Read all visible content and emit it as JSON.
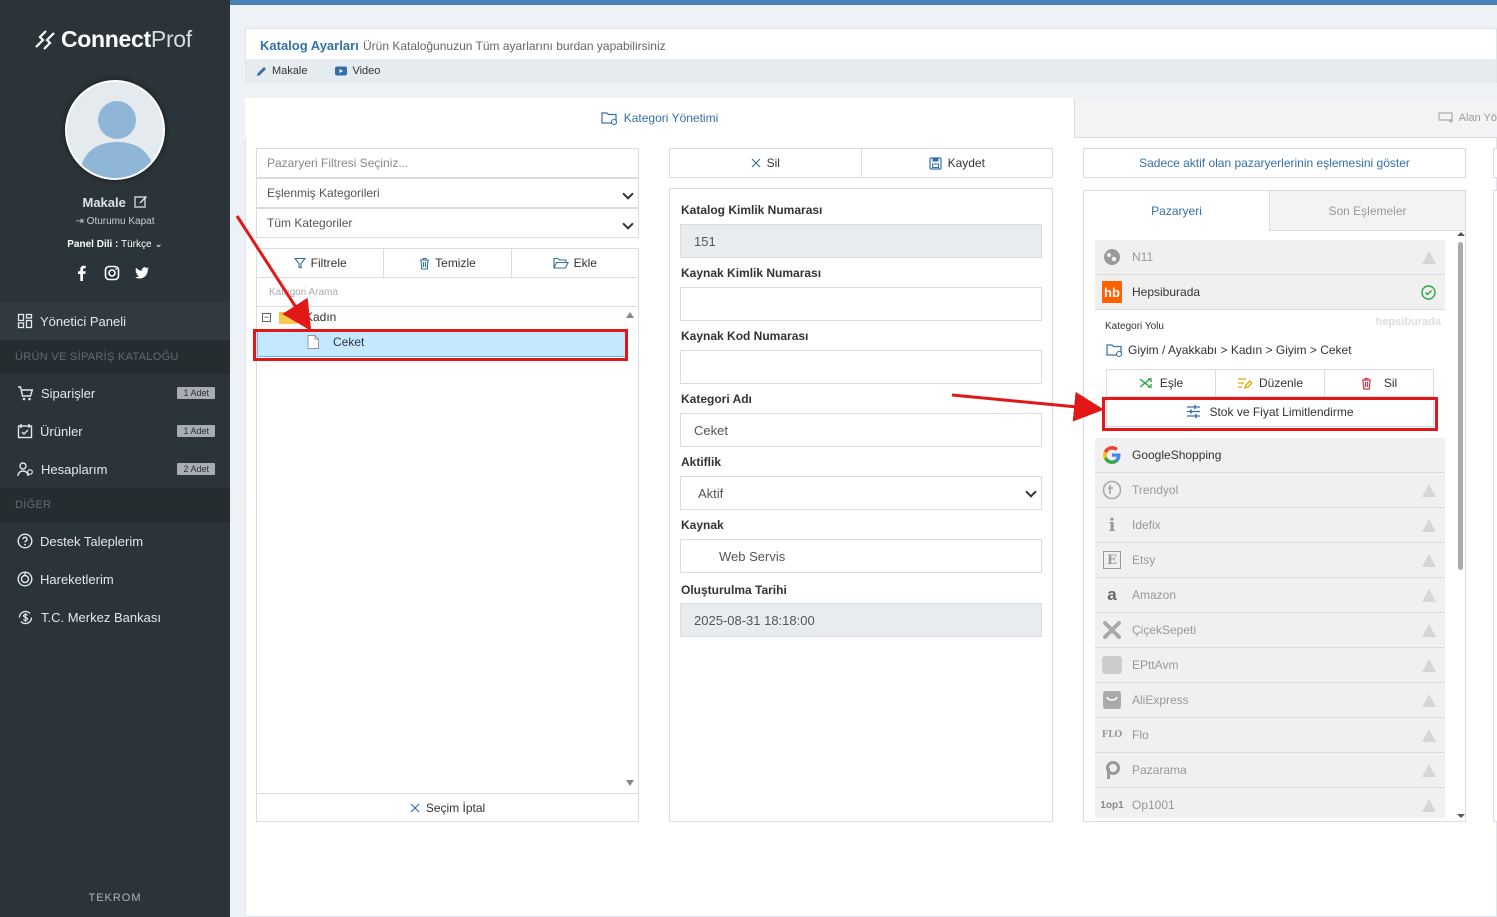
{
  "sidebar": {
    "logo_main": "Connect",
    "logo_suffix": "Prof",
    "user_name": "Makale",
    "logout": "Oturumu Kapat",
    "lang_label": "Panel Dili :",
    "lang_value": "Türkçe",
    "menu": [
      {
        "label": "Yönetici Paneli",
        "icon": "dashboard-icon"
      },
      {
        "section": "ÜRÜN VE SİPARİŞ KATALOĞU"
      },
      {
        "label": "Siparişler",
        "badge": "1 Adet",
        "icon": "cart-icon"
      },
      {
        "label": "Ürünler",
        "badge": "1 Adet",
        "icon": "products-icon"
      },
      {
        "label": "Hesaplarım",
        "badge": "2 Adet",
        "icon": "accounts-icon"
      },
      {
        "section": "DİĞER"
      },
      {
        "label": "Destek Taleplerim",
        "icon": "help-icon"
      },
      {
        "label": "Hareketlerim",
        "icon": "history-icon"
      },
      {
        "label": "T.C. Merkez Bankası",
        "icon": "currency-icon"
      }
    ],
    "footer": "TEKROM"
  },
  "header": {
    "title": "Katalog Ayarları",
    "subtitle": "Ürün Kataloğunuzun Tüm ayarlarını burdan yapabilirsiniz",
    "links": [
      "Makale",
      "Video"
    ]
  },
  "tabs": {
    "active": "Kategori Yönetimi",
    "other": "Alan Yö"
  },
  "left_panel": {
    "filter_placeholder": "Pazaryeri Filtresi Seçiniz...",
    "select1": "Eşlenmiş Kategorileri",
    "select2": "Tüm Kategoriler",
    "buttons": [
      "Filtrele",
      "Temizle",
      "Ekle"
    ],
    "search_placeholder": "Kategori Arama",
    "tree": {
      "parent": "Kadın",
      "child": "Ceket"
    },
    "cancel": "Seçim İptal"
  },
  "middle_panel": {
    "delete": "Sil",
    "save": "Kaydet",
    "fields": [
      {
        "label": "Katalog Kimlik Numarası",
        "value": "151",
        "readonly": true
      },
      {
        "label": "Kaynak Kimlik Numarası",
        "value": ""
      },
      {
        "label": "Kaynak Kod Numarası",
        "value": ""
      },
      {
        "label": "Kategori Adı",
        "value": "Ceket"
      },
      {
        "label": "Aktiflik",
        "value": "Aktif"
      },
      {
        "label": "Kaynak",
        "value": "Web Servis"
      },
      {
        "label": "Oluşturulma Tarihi",
        "value": "2025-08-31 18:18:00",
        "readonly": true
      }
    ]
  },
  "right_panel": {
    "top_button": "Sadece aktif olan pazaryerlerinin eşlemesini göster",
    "tabs": [
      "Pazaryeri",
      "Son Eşlemeler"
    ],
    "hb": {
      "name": "Hepsiburada",
      "category_path_label": "Kategori Yolu",
      "watermark": "hepsiburada",
      "path": "Giyim / Ayakkabı > Kadın > Giyim > Ceket",
      "actions": [
        "Eşle",
        "Düzenle",
        "Sil"
      ],
      "limit_button": "Stok ve Fiyat Limitlendirme"
    },
    "marketplaces": [
      "N11",
      "Hepsiburada",
      "GoogleShopping",
      "Trendyol",
      "Idefix",
      "Etsy",
      "Amazon",
      "ÇiçekSepeti",
      "EPttAvm",
      "AliExpress",
      "Flo",
      "Pazarama",
      "Op1001"
    ]
  },
  "colors": {
    "accent": "#3470a8",
    "sidebar": "#2b3438",
    "highlight": "#e21717",
    "selected": "#c3e8ff"
  }
}
